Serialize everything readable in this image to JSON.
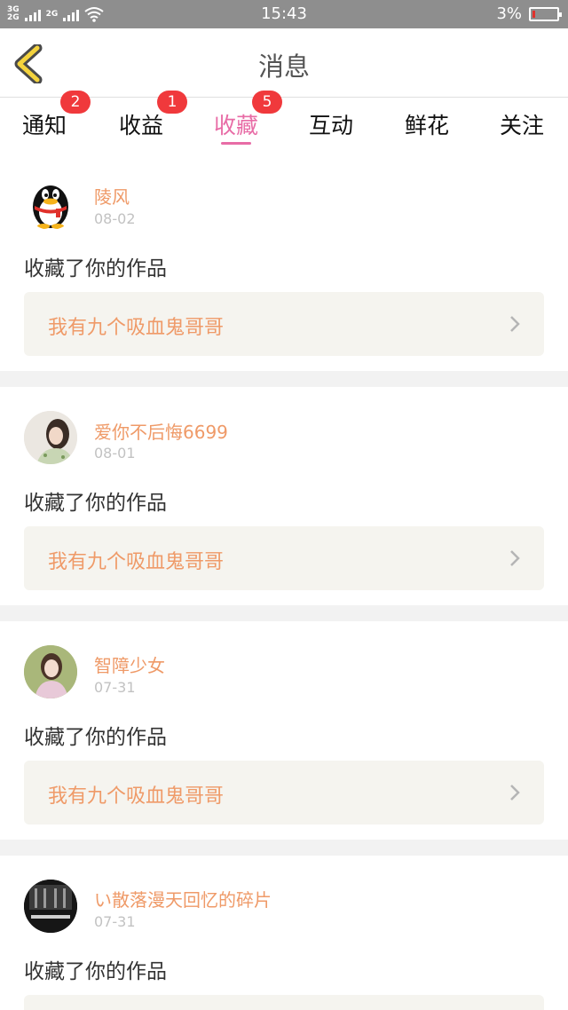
{
  "status_bar": {
    "network1": "3G",
    "network2": "2G",
    "network3": "2G",
    "time": "15:43",
    "battery_percent": "3%",
    "battery_level": 0.03
  },
  "nav": {
    "title": "消息",
    "back_icon": "chevron-left-icon"
  },
  "tabs": [
    {
      "label": "通知",
      "badge": "2"
    },
    {
      "label": "收益",
      "badge": "1"
    },
    {
      "label": "收藏",
      "badge": "5",
      "active": true
    },
    {
      "label": "互动"
    },
    {
      "label": "鲜花"
    },
    {
      "label": "关注"
    }
  ],
  "colors": {
    "accent": "#e86ca6",
    "badge": "#f0393c",
    "username": "#ef9a68",
    "card_bg": "#f5f4ef"
  },
  "items": [
    {
      "user": "陵风",
      "date": "08-02",
      "action": "收藏了你的作品",
      "work": "我有九个吸血鬼哥哥",
      "avatar": "penguin-avatar"
    },
    {
      "user": "爱你不后悔6699",
      "date": "08-01",
      "action": "收藏了你的作品",
      "work": "我有九个吸血鬼哥哥",
      "avatar": "girl-photo-avatar"
    },
    {
      "user": "智障少女",
      "date": "07-31",
      "action": "收藏了你的作品",
      "work": "我有九个吸血鬼哥哥",
      "avatar": "girl-photo-avatar"
    },
    {
      "user": "い散落漫天回忆的碎片",
      "date": "07-31",
      "action": "收藏了你的作品",
      "work": "",
      "avatar": "dark-photo-avatar"
    }
  ]
}
